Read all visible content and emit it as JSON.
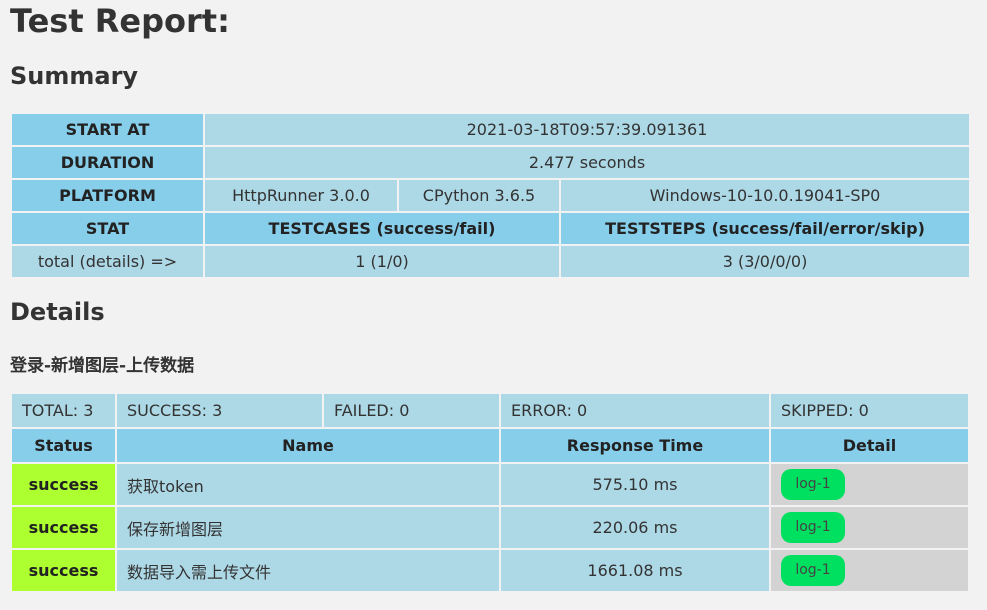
{
  "page": {
    "title": "Test Report:"
  },
  "summary": {
    "heading": "Summary",
    "start_at_label": "START AT",
    "start_at": "2021-03-18T09:57:39.091361",
    "duration_label": "DURATION",
    "duration": "2.477 seconds",
    "platform_label": "PLATFORM",
    "platform": [
      "HttpRunner 3.0.0",
      "CPython 3.6.5",
      "Windows-10-10.0.19041-SP0"
    ],
    "stat_label": "STAT",
    "testcases_label": "TESTCASES (success/fail)",
    "teststeps_label": "TESTSTEPS (success/fail/error/skip)",
    "total_label": "total (details) =>",
    "testcases_value": "1 (1/0)",
    "teststeps_value": "3 (3/0/0/0)"
  },
  "details": {
    "heading": "Details",
    "testcase_title": "登录-新增图层-上传数据",
    "counts": {
      "total": "TOTAL: 3",
      "success": "SUCCESS: 3",
      "failed": "FAILED: 0",
      "error": "ERROR: 0",
      "skipped": "SKIPPED: 0"
    },
    "columns": {
      "status": "Status",
      "name": "Name",
      "response_time": "Response Time",
      "detail": "Detail"
    },
    "rows": [
      {
        "status": "success",
        "name": "获取token",
        "response_time": "575.10 ms",
        "log": "log-1"
      },
      {
        "status": "success",
        "name": "保存新增图层",
        "response_time": "220.06 ms",
        "log": "log-1"
      },
      {
        "status": "success",
        "name": "数据导入需上传文件",
        "response_time": "1661.08 ms",
        "log": "log-1"
      }
    ]
  }
}
